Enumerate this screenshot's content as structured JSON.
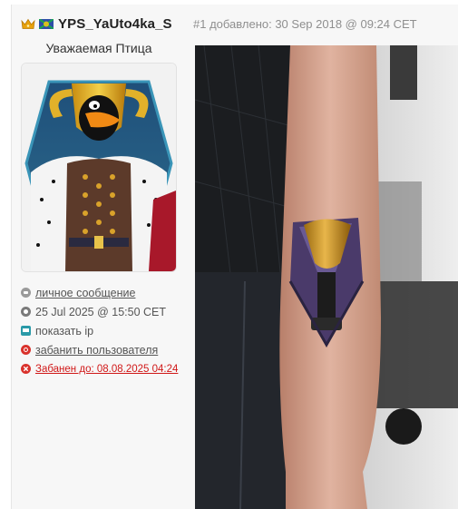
{
  "post": {
    "username": "YPS_YaUto4ka_S",
    "info": "#1 добавлено: 30 Sep 2018 @ 09:24 CET",
    "user_title": "Уважаемая Птица"
  },
  "links": {
    "message": "личное сообщение",
    "last_seen": "25 Jul 2025 @ 15:50 CET",
    "show_ip": "показать ip",
    "ban_user": "забанить пользователя",
    "banned_until": "Забанен до: 08.08.2025 04:24"
  },
  "colors": {
    "crown": "#e8a20c",
    "icon_grey": "#9a9a9a",
    "icon_teal": "#2a9aa8",
    "icon_red": "#d9322c",
    "banned_text": "#d01818"
  },
  "icons": [
    "crown-icon",
    "flag-icon",
    "message-icon",
    "clock-icon",
    "ip-icon",
    "power-icon",
    "banned-icon"
  ]
}
